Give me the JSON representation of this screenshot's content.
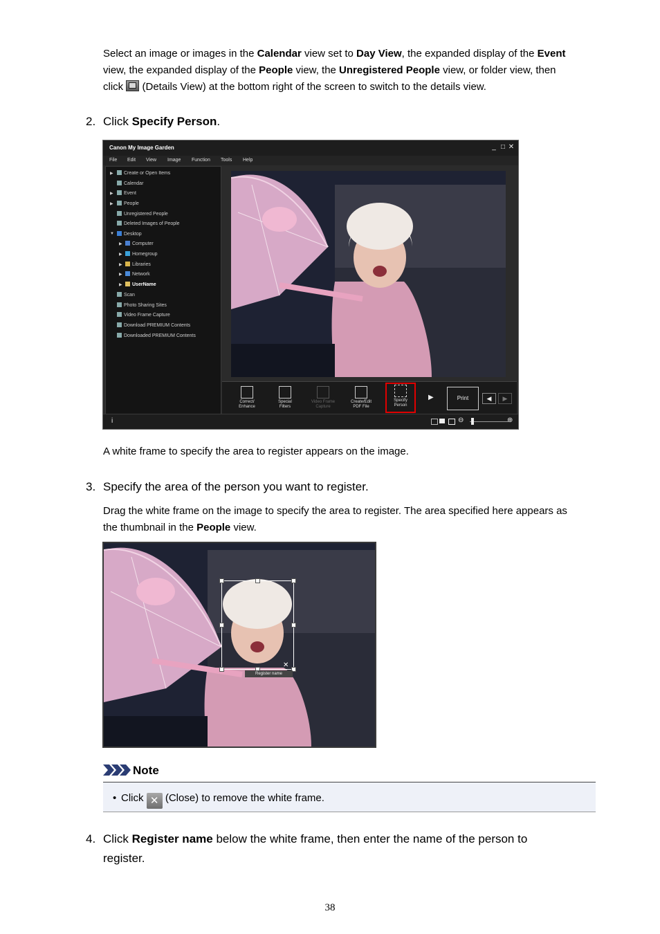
{
  "intro": {
    "t1": "Select an image or images in the ",
    "b1": "Calendar",
    "t2": " view set to ",
    "b2": "Day View",
    "t3": ", the expanded display of the ",
    "b3": "Event",
    "t4": "view, the expanded display of the ",
    "b4": "People",
    "t5": " view, the ",
    "b5": "Unregistered People",
    "t6": " view, or folder view, then",
    "t7": "click ",
    "t8": " (Details View) at the bottom right of the screen to switch to the details view."
  },
  "step2": {
    "num": "2.",
    "t1": "Click ",
    "b1": "Specify Person",
    "t2": "."
  },
  "app": {
    "title": "Canon My Image Garden",
    "window_buttons": [
      "_",
      "□",
      "✕"
    ],
    "menu": [
      "File",
      "Edit",
      "View",
      "Image",
      "Function",
      "Tools",
      "Help"
    ],
    "sidebar": [
      "Create or Open Items",
      "Calendar",
      "Event",
      "People",
      "Unregistered People",
      "Deleted Images of People",
      "Desktop",
      "Computer",
      "Homegroup",
      "Libraries",
      "Network",
      "UserName",
      "Scan",
      "Photo Sharing Sites",
      "Video Frame Capture",
      "Download PREMIUM Contents",
      "Downloaded PREMIUM Contents"
    ],
    "tools": [
      {
        "l1": "Correct/",
        "l2": "Enhance"
      },
      {
        "l1": "Special",
        "l2": "Filters"
      },
      {
        "l1": "Video Frame",
        "l2": "Capture"
      },
      {
        "l1": "Create/Edit",
        "l2": "PDF File"
      },
      {
        "l1": "Specify",
        "l2": "Person"
      }
    ],
    "print_label": "Print",
    "info_icon_text": "i"
  },
  "after_app": "A white frame to specify the area to register appears on the image.",
  "step3": {
    "num": "3.",
    "text": "Specify the area of the person you want to register."
  },
  "step3_desc": {
    "t1": "Drag the white frame on the image to specify the area to register. The area specified here appears as",
    "t2": "the thumbnail in the ",
    "b1": "People",
    "t3": " view."
  },
  "photo2": {
    "register_label": "Register name",
    "close_glyph": "✕"
  },
  "note": {
    "title": "Note",
    "bullet": "•",
    "t1": "Click ",
    "t2": " (Close) to remove the white frame."
  },
  "step4": {
    "num": "4.",
    "t1": "Click ",
    "b1": "Register name",
    "t2": " below the white frame, then enter the name of the person to",
    "t3": "register."
  },
  "page_number": "38"
}
